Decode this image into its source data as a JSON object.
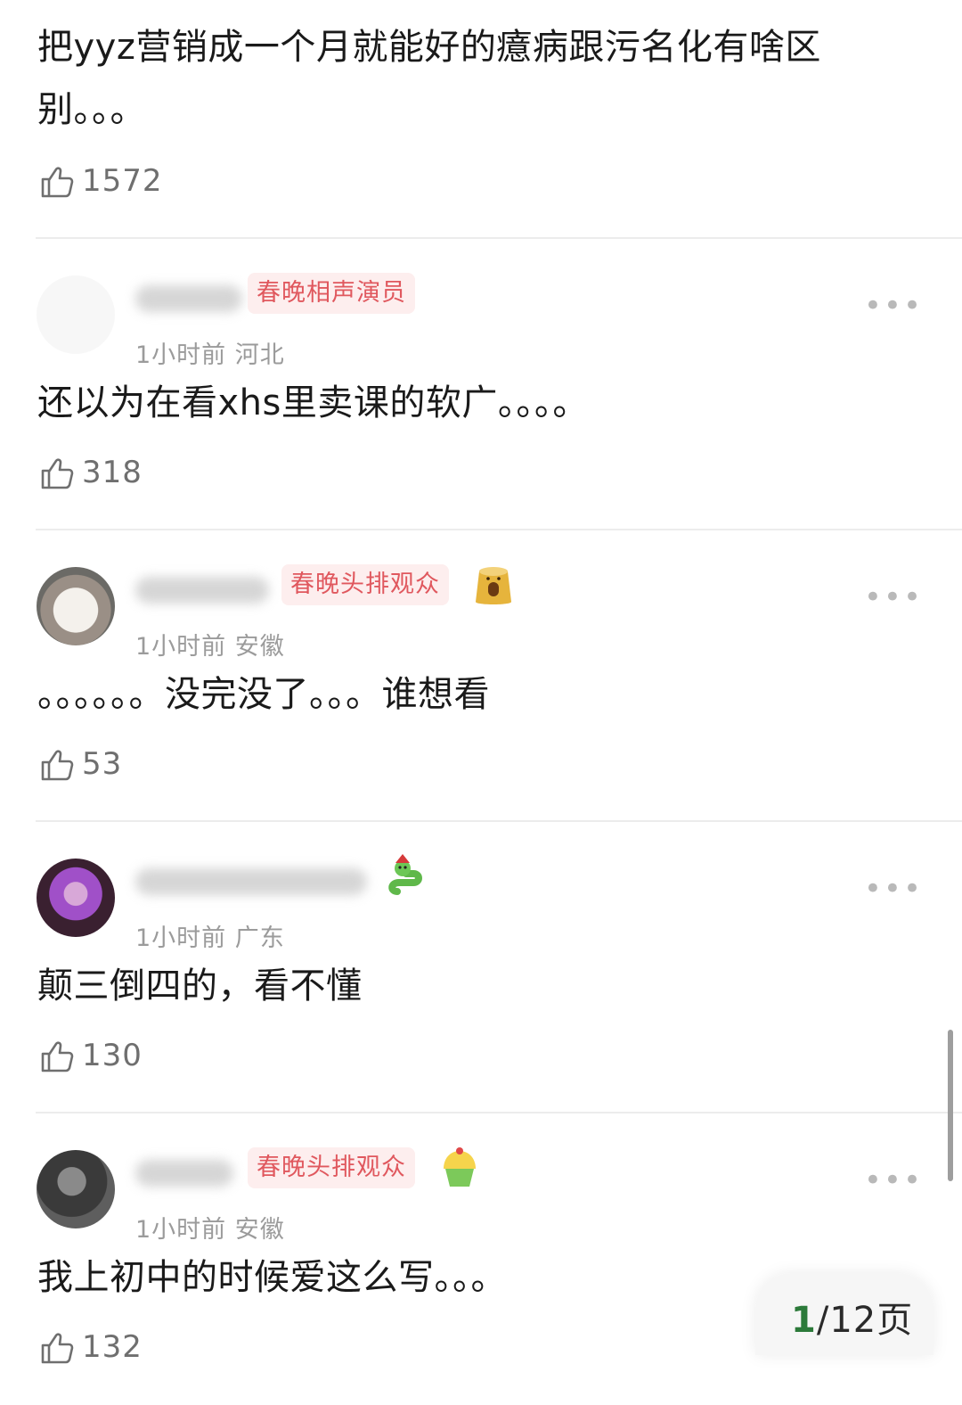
{
  "first_comment": {
    "text": "把yyz营销成一个月就能好的癔病跟污名化有啥区别。。。",
    "likes": "1572"
  },
  "comments": [
    {
      "name": "",
      "badge": "春晚相声演员",
      "time": "1小时前 河北",
      "text": "还以为在看xhs里卖课的软广。。。。",
      "likes": "318",
      "avatar_icon": "blank-avatar"
    },
    {
      "name": "",
      "badge": "春晚头排观众",
      "time": "1小时前 安徽",
      "text": "。。。。。。没完没了。。。谁想看",
      "likes": "53",
      "avatar_icon": "cat-avatar",
      "decoration_icon": "tree-stump-icon"
    },
    {
      "name": "",
      "badge": "",
      "time": "1小时前 广东",
      "text": "颠三倒四的，看不懂",
      "likes": "130",
      "avatar_icon": "purple-hair-avatar",
      "decoration_icon": "snake-icon"
    },
    {
      "name": "",
      "badge": "春晚头排观众",
      "time": "1小时前 安徽",
      "text": "我上初中的时候爱这么写。。。",
      "likes": "132",
      "avatar_icon": "dark-avatar",
      "decoration_icon": "cupcake-icon"
    }
  ],
  "pager": {
    "current": "1",
    "rest": "/12页"
  },
  "colors": {
    "badge_bg": "#fdeeee",
    "badge_text": "#e0585e",
    "meta_text": "#9b9b9b",
    "divider": "#ececec"
  }
}
